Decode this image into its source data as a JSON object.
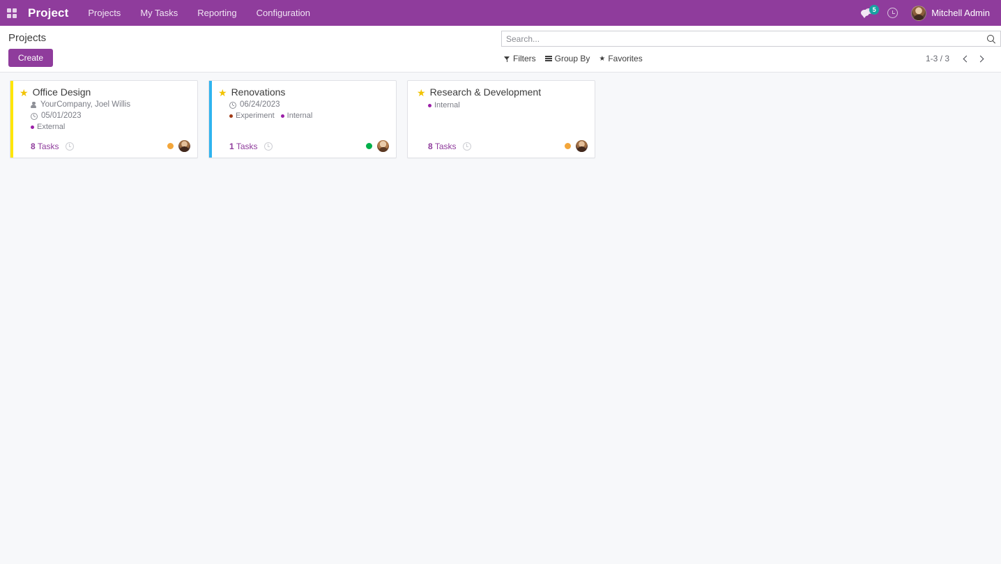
{
  "navbar": {
    "apps_icon": "apps-grid-icon",
    "brand": "Project",
    "menu": [
      {
        "label": "Projects"
      },
      {
        "label": "My Tasks"
      },
      {
        "label": "Reporting"
      },
      {
        "label": "Configuration"
      }
    ],
    "messages_icon": "messages-icon",
    "messages_count": "5",
    "activities_icon": "clock-icon",
    "user": {
      "name": "Mitchell Admin",
      "avatar_icon": "user-avatar"
    },
    "background_color": "#8f3c9c",
    "badge_color": "#17a2a2"
  },
  "control_panel": {
    "breadcrumb": "Projects",
    "create_label": "Create",
    "search": {
      "placeholder": "Search...",
      "value": "",
      "icon": "search-icon"
    },
    "filter_buttons": [
      {
        "label": "Filters",
        "icon": "funnel-icon"
      },
      {
        "label": "Group By",
        "icon": "bars-icon"
      },
      {
        "label": "Favorites",
        "icon": "star-icon"
      }
    ],
    "pager": {
      "value": "1-3 / 3",
      "prev_icon": "chevron-left-icon",
      "next_icon": "chevron-right-icon"
    }
  },
  "kanban": {
    "cards": [
      {
        "title": "Office Design",
        "favorite": true,
        "stripe_color": "#ffe600",
        "customer": "YourCompany, Joel Willis",
        "date": "05/01/2023",
        "tags": [
          {
            "label": "External",
            "color": "#9b1fa8"
          }
        ],
        "tasks_count": "8",
        "tasks_label": "Tasks",
        "status_color": "#f3a63a",
        "avatar": "a-admin"
      },
      {
        "title": "Renovations",
        "favorite": true,
        "stripe_color": "#30b4ef",
        "customer": "",
        "date": "06/24/2023",
        "tags": [
          {
            "label": "Experiment",
            "color": "#a13b16"
          },
          {
            "label": "Internal",
            "color": "#9b1fa8"
          }
        ],
        "tasks_count": "1",
        "tasks_label": "Tasks",
        "status_color": "#00b04a",
        "avatar": "a-user"
      },
      {
        "title": "Research & Development",
        "favorite": true,
        "stripe_color": "transparent",
        "customer": "",
        "date": "",
        "tags": [
          {
            "label": "Internal",
            "color": "#9b1fa8"
          }
        ],
        "tasks_count": "8",
        "tasks_label": "Tasks",
        "status_color": "#f3a63a",
        "avatar": "a-admin"
      }
    ]
  }
}
